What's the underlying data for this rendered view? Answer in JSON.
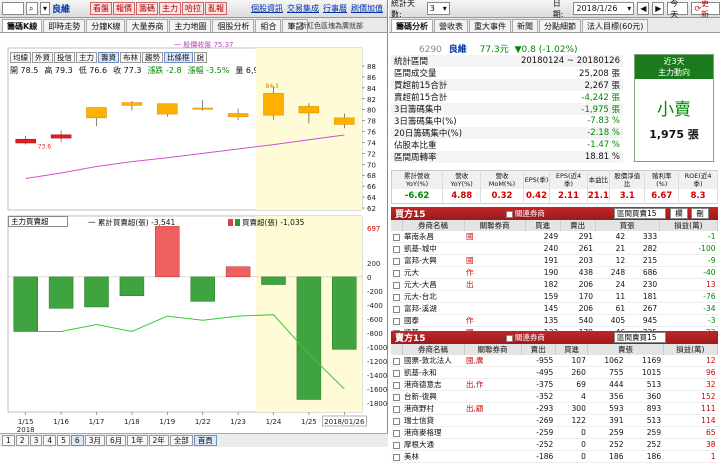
{
  "left": {
    "toolbar": {
      "stock_name": "良維",
      "buttons": [
        "看盤",
        "報價",
        "籌碼",
        "主力",
        "哈拉",
        "亂報"
      ],
      "links": [
        "個股資訊",
        "交易集成",
        "行事曆",
        "刷價加值"
      ]
    },
    "tabs": [
      "籌碼K線",
      "即時走勢",
      "分鐘K線",
      "大量券商",
      "主力地圖",
      "個股分析",
      "組合",
      "筆記"
    ],
    "notice": "新紅色區塊為廣就部",
    "subbuttons": [
      "均線",
      "外資",
      "投信",
      "主力",
      "籌資",
      "布林",
      "趨勢",
      "比條框",
      "說"
    ],
    "ohlc": {
      "open": "開 78.5",
      "high": "高 79.3",
      "low": "低 76.6",
      "close": "收 77.3",
      "chg": "漲跌 -2.8",
      "chg_pct": "漲幅 -3.5%",
      "vol": "量 6,942"
    },
    "ma_label": "一 股價收盤 75.37",
    "price_axis": [
      "88",
      "86",
      "84",
      "82",
      "80",
      "78",
      "76",
      "74",
      "72",
      "70",
      "68",
      "66",
      "64",
      "62"
    ],
    "price_tag_hi": "84.3",
    "price_tag_lo": "73.6",
    "sub": {
      "select": "主力買賣超",
      "legend1": "一 累計買賣超(張) -3,541",
      "legend2": "買賣超(張) -1,035",
      "axis": [
        "697",
        "200",
        "0",
        "-200",
        "-400",
        "-600",
        "-800",
        "-1000",
        "-1200",
        "-1400",
        "-1600",
        "-1800"
      ]
    },
    "dates": [
      "1/15",
      "1/16",
      "1/17",
      "1/18",
      "1/19",
      "1/22",
      "1/23",
      "1/24",
      "1/25",
      "2018/01/26"
    ],
    "year": "2018",
    "bottom": [
      "1",
      "2",
      "3",
      "4",
      "5",
      "6",
      "3月",
      "6月",
      "1年",
      "2年",
      "全部",
      "首頁"
    ]
  },
  "chart_data": {
    "type": "candlestick",
    "x": [
      "1/15",
      "1/16",
      "1/17",
      "1/18",
      "1/19",
      "1/22",
      "1/23",
      "1/24",
      "1/25",
      "1/26"
    ],
    "ohlc": [
      [
        74.6,
        75.2,
        73.6,
        73.9
      ],
      [
        75.4,
        76.2,
        74.1,
        74.8
      ],
      [
        78.5,
        79.1,
        77.0,
        80.4
      ],
      [
        80.8,
        81.6,
        79.9,
        81.3
      ],
      [
        79.2,
        80.7,
        78.7,
        81.1
      ],
      [
        80.1,
        81.8,
        79.8,
        80.3
      ],
      [
        78.7,
        80.2,
        78.1,
        79.3
      ],
      [
        83.0,
        84.3,
        78.2,
        79.0
      ],
      [
        80.6,
        81.2,
        77.5,
        79.4
      ],
      [
        78.5,
        79.3,
        76.6,
        77.3
      ]
    ],
    "ma": [
      67.4,
      68.4,
      69.6,
      70.5,
      71.2,
      72.0,
      72.8,
      73.6,
      74.5,
      75.37
    ],
    "netbuy": [
      -780,
      -450,
      -430,
      -270,
      720,
      -350,
      145,
      -110,
      -1750,
      -1035
    ],
    "cum": [
      -780,
      -780,
      -680,
      -780,
      -560,
      -620,
      -560,
      -540,
      -1100,
      -1600
    ],
    "price_range": [
      62,
      88
    ],
    "netbuy_range": [
      -1900,
      697
    ]
  },
  "right": {
    "toolbar": {
      "days_label": "統計天數:",
      "days_value": "3",
      "date_label": "日期:",
      "date_value": "2018/1/26",
      "today": "今天",
      "refresh": "更新"
    },
    "tabs": [
      "籌碼分析",
      "營收表",
      "重大事件",
      "新聞",
      "分點細節",
      "法人目標(60元)"
    ],
    "code": "6290",
    "name": "良維",
    "price": "77.3元",
    "chg": "▼0.8 (-1.02%)",
    "stats": [
      {
        "k": "統計區間",
        "v": "20180124 ~ 20180126"
      },
      {
        "k": "區間成交量",
        "v": "25,208 張"
      },
      {
        "k": "買超前15合計",
        "v": "2,267 張"
      },
      {
        "k": "賣超前15合計",
        "v": "-4,242 張"
      },
      {
        "k": "3日籌碼集中",
        "v": "-1,975 張"
      },
      {
        "k": "3日籌碼集中(%)",
        "v": "-7.83 %"
      },
      {
        "k": "20日籌碼集中(%)",
        "v": "-2.18 %"
      },
      {
        "k": "佔股本比重",
        "v": "-1.47 %"
      },
      {
        "k": "區間周轉率",
        "v": "18.81 %"
      }
    ],
    "trend": {
      "head": "近3天",
      "sub": "主力動向",
      "main": "小賣",
      "value": "1,975 張"
    },
    "metrics_h": [
      "累計營收YoY(%)",
      "營收YoY(%)",
      "營收MoM(%)",
      "EPS(季)",
      "EPS(近4季)",
      "本益比",
      "股價淨值比",
      "殖利率(%)",
      "ROE(近4季)"
    ],
    "metrics_v": [
      "-6.62",
      "4.88",
      "0.32",
      "0.42",
      "2.11",
      "21.1",
      "3.1",
      "6.67",
      "8.3"
    ],
    "buy": {
      "title": "買方15",
      "label": "關連券商",
      "select": "區間買賣15",
      "btn1": "欄",
      "btn2": "刪",
      "cols": [
        "券商名稱",
        "關聯券商",
        "買進",
        "賣出",
        "買張",
        "損益(萬)"
      ],
      "rows": [
        [
          "華南永昌",
          "國",
          "249",
          "291",
          "42",
          "333",
          "-1"
        ],
        [
          "凱基-城中",
          "",
          "240",
          "261",
          "21",
          "282",
          "-100"
        ],
        [
          "富邦-大興",
          "國",
          "191",
          "203",
          "12",
          "215",
          "-9"
        ],
        [
          "元大",
          "作",
          "190",
          "438",
          "248",
          "686",
          "-40"
        ],
        [
          "元大-大昌",
          "出",
          "182",
          "206",
          "24",
          "230",
          "13"
        ],
        [
          "元大-台北",
          "",
          "159",
          "170",
          "11",
          "181",
          "-76"
        ],
        [
          "富邦-溪湖",
          "",
          "145",
          "206",
          "61",
          "267",
          "-34"
        ],
        [
          "國泰",
          "作",
          "135",
          "540",
          "405",
          "945",
          "-3"
        ],
        [
          "凱基",
          "國",
          "133",
          "179",
          "46",
          "225",
          "-22"
        ]
      ]
    },
    "sell": {
      "title": "賣方15",
      "label": "關連券商",
      "select": "區間賣買15",
      "cols": [
        "券商名稱",
        "關聯券商",
        "賣出",
        "買進",
        "賣張",
        "損益(萬)"
      ],
      "rows": [
        [
          "國票-敦北法人",
          "國,廣",
          "-955",
          "107",
          "1062",
          "1169",
          "12"
        ],
        [
          "凱基-永和",
          "",
          "-495",
          "260",
          "755",
          "1015",
          "96"
        ],
        [
          "港商德意志",
          "出,作",
          "-375",
          "69",
          "444",
          "513",
          "32"
        ],
        [
          "台新-復興",
          "",
          "-352",
          "4",
          "356",
          "360",
          "152"
        ],
        [
          "港商野村",
          "出,顧",
          "-293",
          "300",
          "593",
          "893",
          "111"
        ],
        [
          "瑞士信貸",
          "",
          "-269",
          "122",
          "391",
          "513",
          "114"
        ],
        [
          "港商麥格理",
          "",
          "-259",
          "0",
          "259",
          "259",
          "65"
        ],
        [
          "摩根大通",
          "",
          "-252",
          "0",
          "252",
          "252",
          "38"
        ],
        [
          "美林",
          "",
          "-186",
          "0",
          "186",
          "186",
          "1"
        ]
      ]
    }
  }
}
